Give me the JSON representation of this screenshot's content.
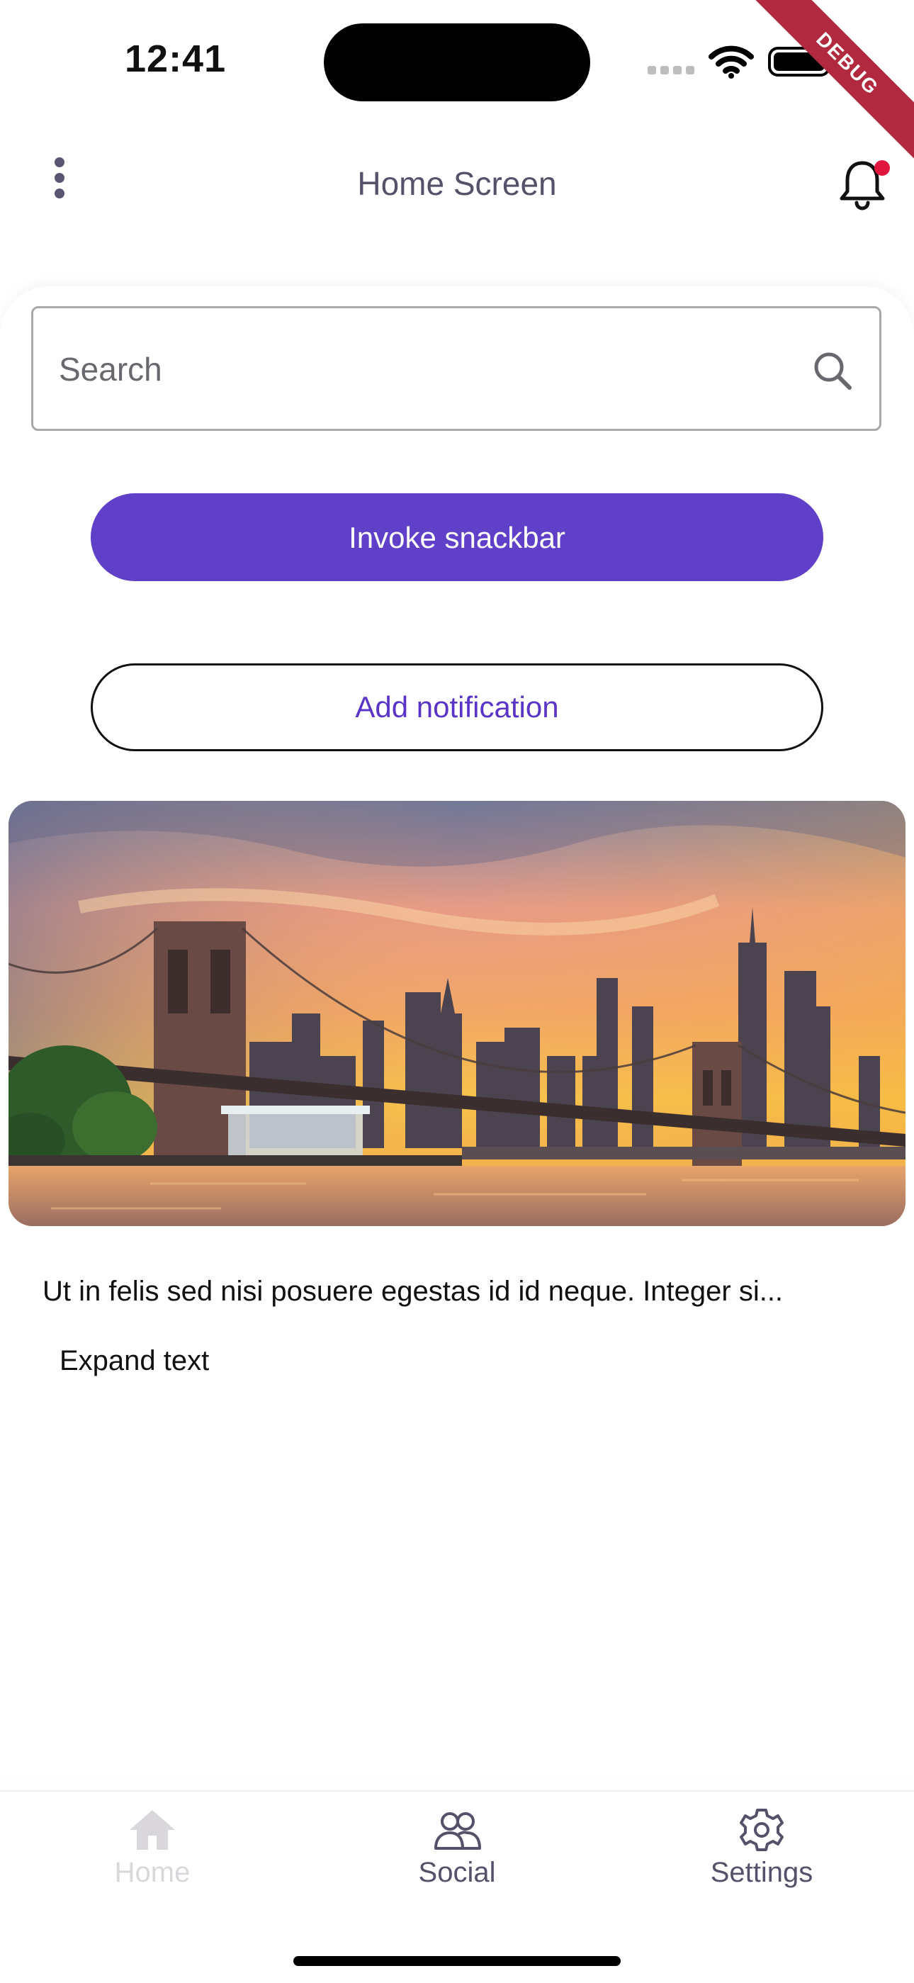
{
  "status_bar": {
    "time": "12:41"
  },
  "debug_banner": {
    "label": "DEBUG"
  },
  "app_bar": {
    "title": "Home Screen"
  },
  "search": {
    "placeholder": "Search",
    "value": ""
  },
  "buttons": {
    "invoke_snackbar": "Invoke snackbar",
    "add_notification": "Add notification"
  },
  "content": {
    "body_text": "Ut in felis sed nisi posuere egestas id id neque. Integer si...",
    "expand_label": "Expand text"
  },
  "bottom_nav": {
    "items": [
      {
        "label": "Home",
        "icon": "home-icon",
        "active": false
      },
      {
        "label": "Social",
        "icon": "people-icon",
        "active": true
      },
      {
        "label": "Settings",
        "icon": "gear-icon",
        "active": true
      }
    ]
  },
  "colors": {
    "primary": "#6040c8",
    "primary_text": "#5a34c6",
    "title": "#55516a",
    "badge": "#e0163f",
    "debug": "#b0293f"
  }
}
